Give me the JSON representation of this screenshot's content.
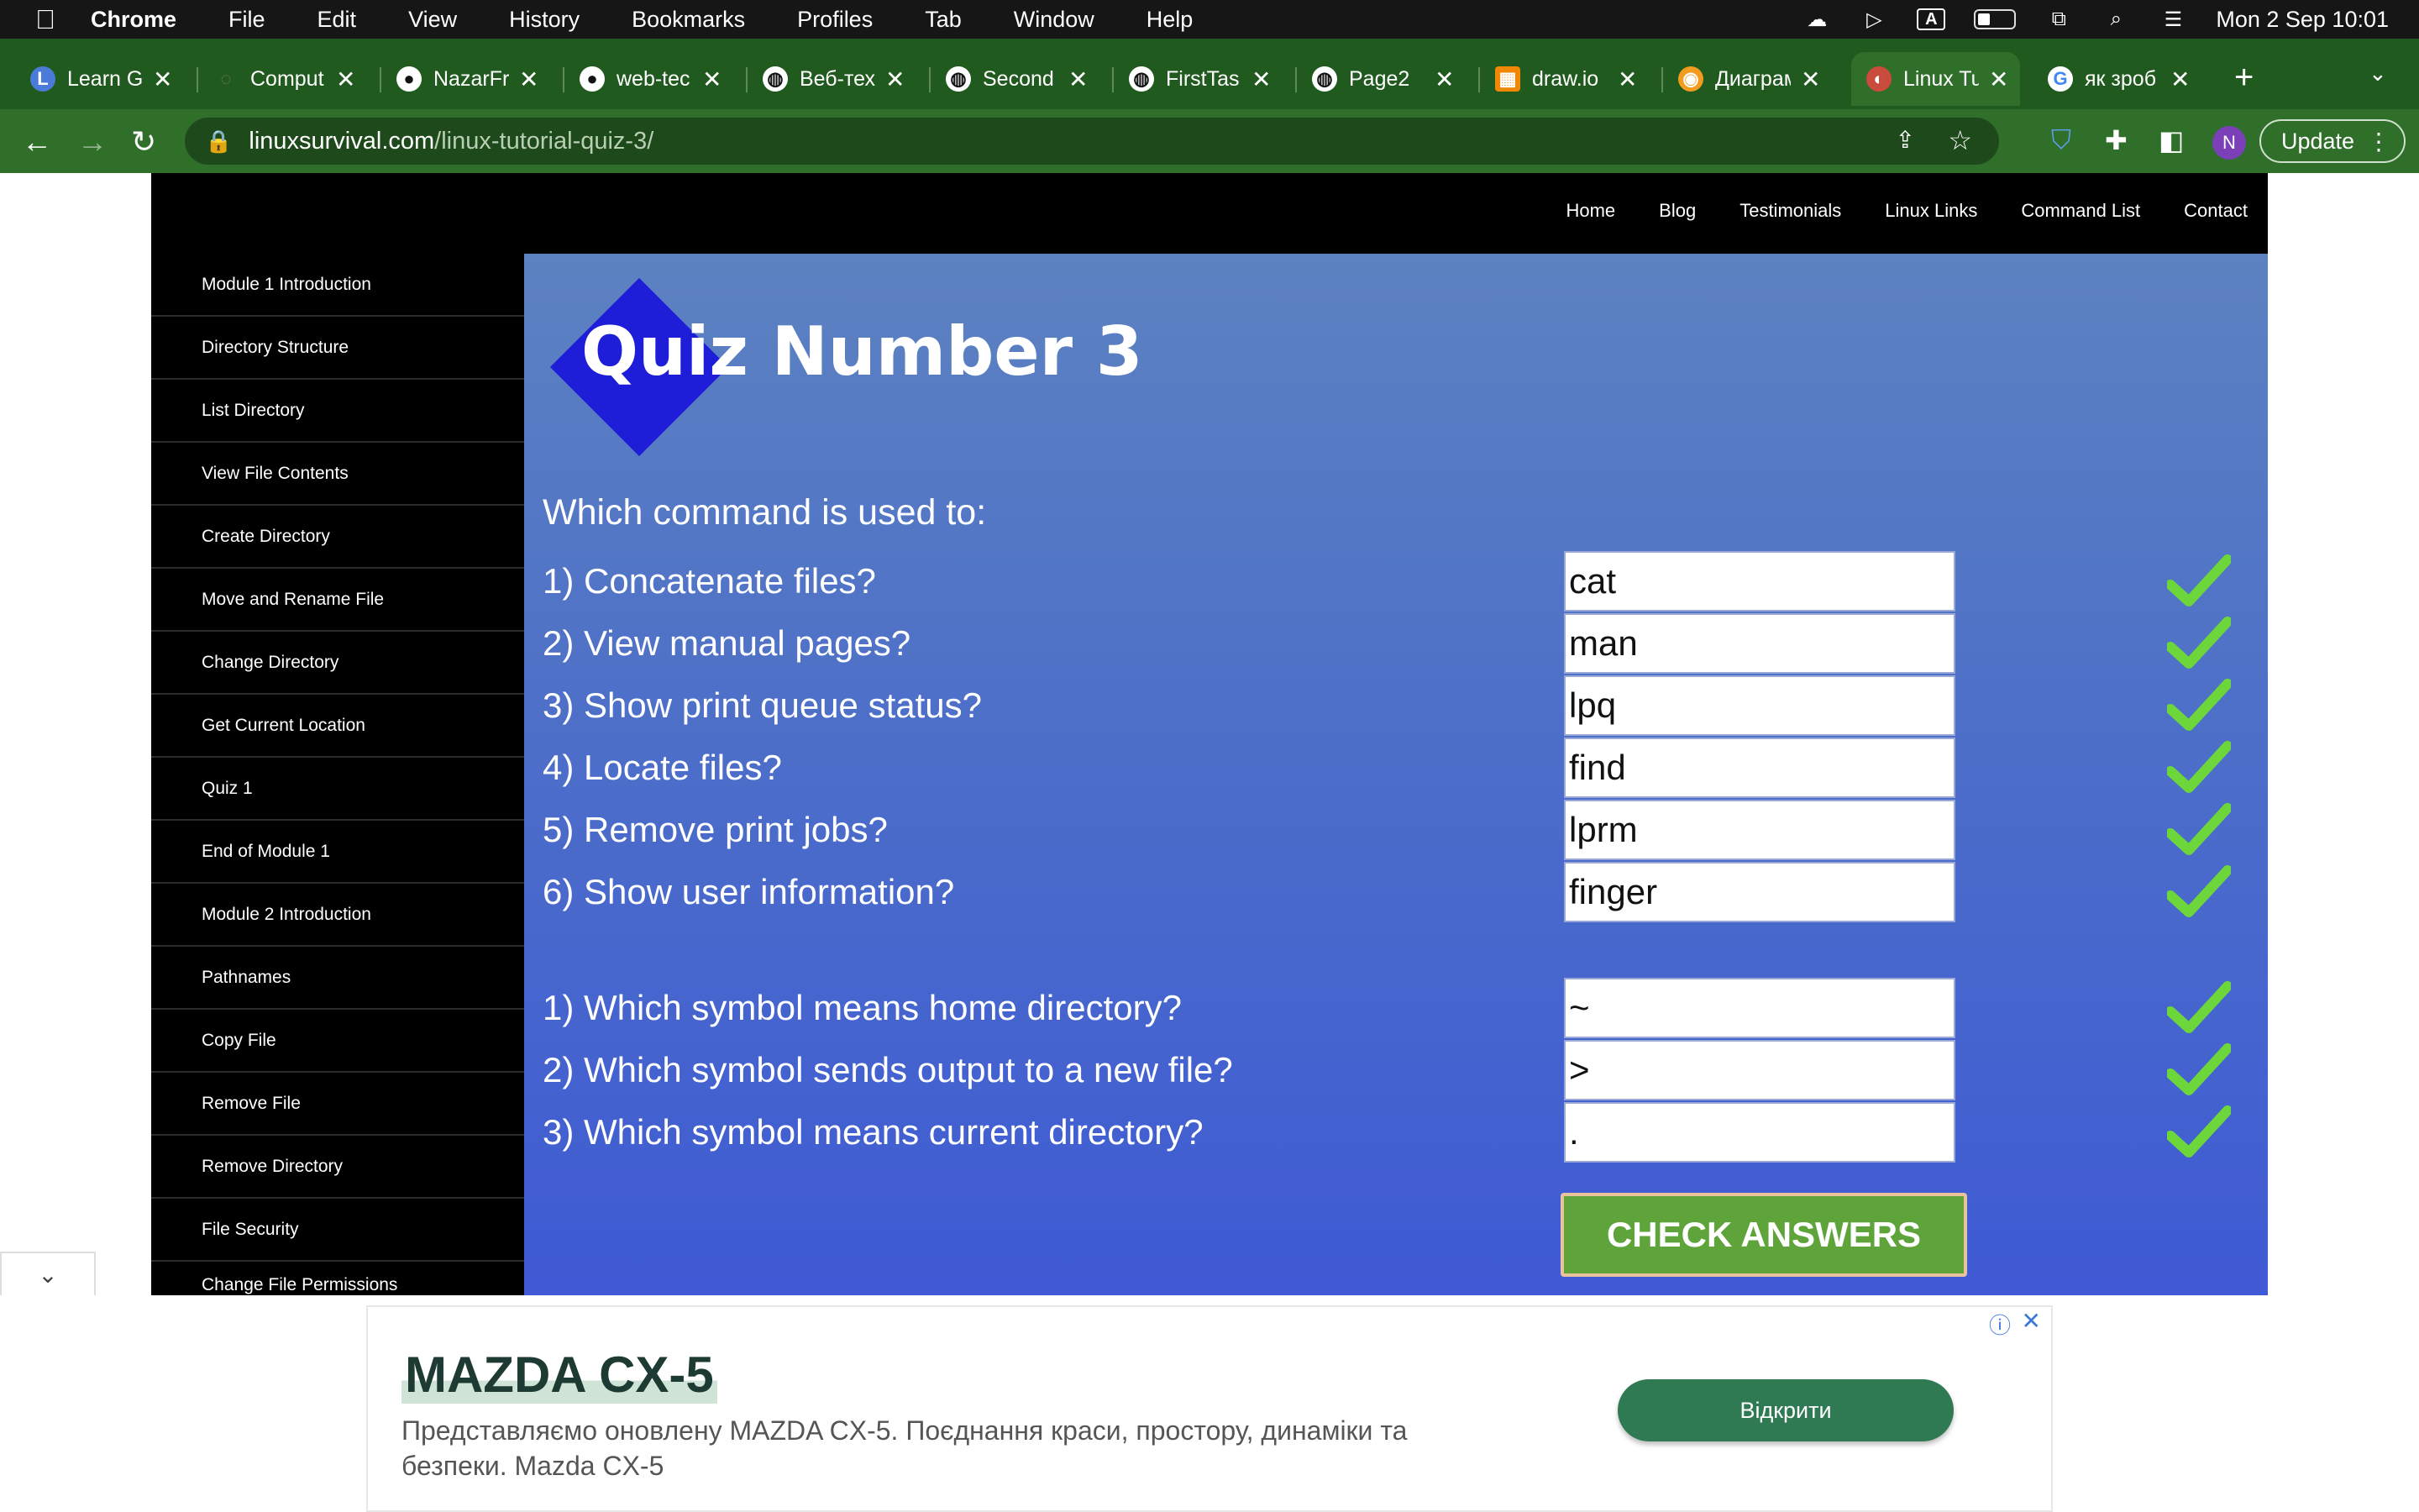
{
  "menubar": {
    "apple": "",
    "app_name": "Chrome",
    "items": [
      "File",
      "Edit",
      "View",
      "History",
      "Bookmarks",
      "Profiles",
      "Tab",
      "Window",
      "Help"
    ],
    "clock": "Mon 2 Sep  10:01",
    "input_source": "A"
  },
  "tabs": [
    {
      "title": "Learn G",
      "favicon": "L",
      "fav_color": "#4a7bd8"
    },
    {
      "title": "Comput",
      "favicon": "◌",
      "fav_color": "#555555"
    },
    {
      "title": "NazarFr",
      "favicon": "●",
      "fav_color": "#111111"
    },
    {
      "title": "web-tec",
      "favicon": "●",
      "fav_color": "#111111"
    },
    {
      "title": "Веб-тех",
      "favicon": "◍",
      "fav_color": "#111111"
    },
    {
      "title": "Second",
      "favicon": "◍",
      "fav_color": "#111111"
    },
    {
      "title": "FirstTas",
      "favicon": "◍",
      "fav_color": "#111111"
    },
    {
      "title": "Page2",
      "favicon": "◍",
      "fav_color": "#111111"
    },
    {
      "title": "draw.io",
      "favicon": "▦",
      "fav_color": "#f08705"
    },
    {
      "title": "Диаграм",
      "favicon": "◉",
      "fav_color": "#f29b1d"
    },
    {
      "title": "Linux Tu",
      "favicon": "◐",
      "fav_color": "#c94b3b"
    },
    {
      "title": "як зроб",
      "favicon": "G",
      "fav_color": "#ffffff"
    }
  ],
  "toolbar": {
    "url_host": "linuxsurvival.com",
    "url_path": "/linux-tutorial-quiz-3/",
    "profile_initial": "N",
    "update_label": "Update"
  },
  "site": {
    "nav": [
      "Home",
      "Blog",
      "Testimonials",
      "Linux Links",
      "Command List",
      "Contact"
    ],
    "sidebar": [
      "Module 1 Introduction",
      "Directory Structure",
      "List Directory",
      "View File Contents",
      "Create Directory",
      "Move and Rename File",
      "Change Directory",
      "Get Current Location",
      "Quiz 1",
      "End of Module 1",
      "Module 2 Introduction",
      "Pathnames",
      "Copy File",
      "Remove File",
      "Remove Directory",
      "File Security",
      "Change File Permissions"
    ]
  },
  "quiz": {
    "title": "Quiz Number 3",
    "intro": "Which command is used to:",
    "questions": [
      {
        "text": "1) Concatenate files?",
        "answer": "cat",
        "correct": true
      },
      {
        "text": "2) View manual pages?",
        "answer": "man",
        "correct": true
      },
      {
        "text": "3) Show print queue status?",
        "answer": "lpq",
        "correct": true
      },
      {
        "text": "4) Locate files?",
        "answer": "find",
        "correct": true
      },
      {
        "text": "5) Remove print jobs?",
        "answer": "lprm",
        "correct": true
      },
      {
        "text": "6) Show user information?",
        "answer": "finger",
        "correct": true
      }
    ],
    "symbol_questions": [
      {
        "text": "1) Which symbol means home directory?",
        "answer": "~",
        "correct": true
      },
      {
        "text": "2) Which symbol sends output to a new file?",
        "answer": ">",
        "correct": true
      },
      {
        "text": "3) Which symbol means current directory?",
        "answer": ".",
        "correct": true
      }
    ],
    "check_button": "CHECK ANSWERS",
    "check_color": "#5ea43a"
  },
  "ad": {
    "title": "MAZDA CX-5",
    "description": "Представляємо оновлену MAZDA CX-5. Поєднання краси, простору, динаміки та безпеки. Mazda CX-5",
    "button": "Відкрити",
    "info_icon": "ⓘ",
    "close_icon": "✕"
  },
  "colors": {
    "chrome_frame": "#215a1f",
    "toolbar": "#2f6f2a",
    "quiz_bg": "#4d6fc8",
    "diamond": "#1e1ed8",
    "checkmark": "#6cd63a"
  }
}
